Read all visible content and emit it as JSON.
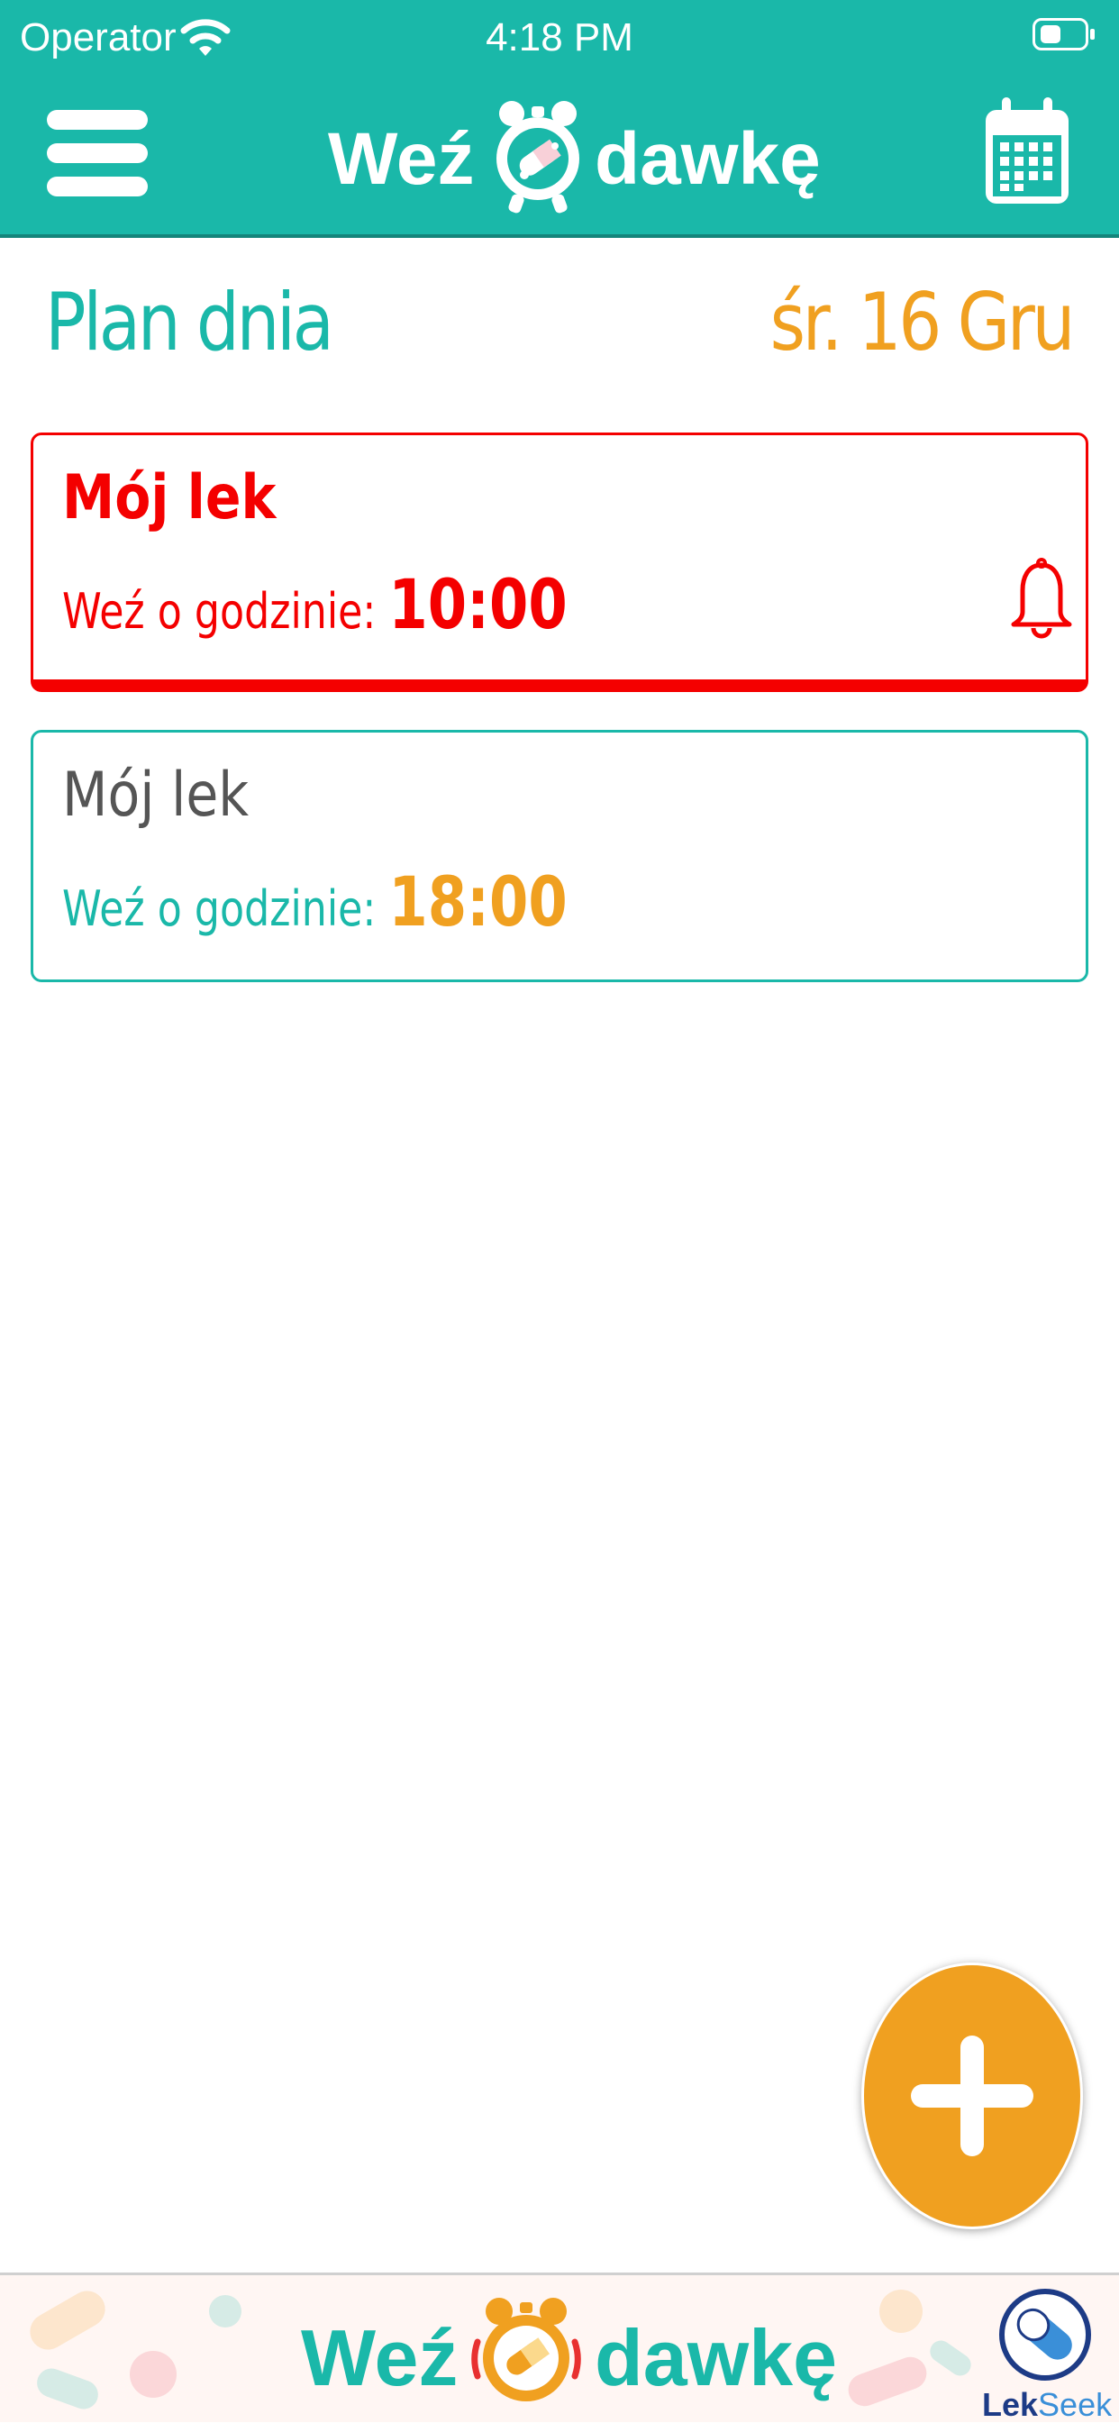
{
  "status_bar": {
    "carrier": "Operator",
    "time": "4:18 PM"
  },
  "nav": {
    "logo_left": "Weź",
    "logo_right": "dawkę",
    "menu_icon": "hamburger-menu-icon",
    "calendar_icon": "calendar-icon"
  },
  "header": {
    "title": "Plan dnia",
    "date": "śr. 16 Gru"
  },
  "doses": [
    {
      "name": "Mój lek",
      "label": "Weź o godzinie: ",
      "time": "10:00",
      "state": "due",
      "icon": "bell-icon"
    },
    {
      "name": "Mój lek",
      "label": "Weź o godzinie: ",
      "time": "18:00",
      "state": "upcoming"
    }
  ],
  "fab": {
    "icon": "plus-icon"
  },
  "footer": {
    "logo_left": "Weź",
    "logo_right": "dawkę",
    "partner_a": "Lek",
    "partner_b": "Seek"
  },
  "colors": {
    "primary": "#1ab8a9",
    "accent": "#f0a020",
    "alert": "#f40000"
  }
}
